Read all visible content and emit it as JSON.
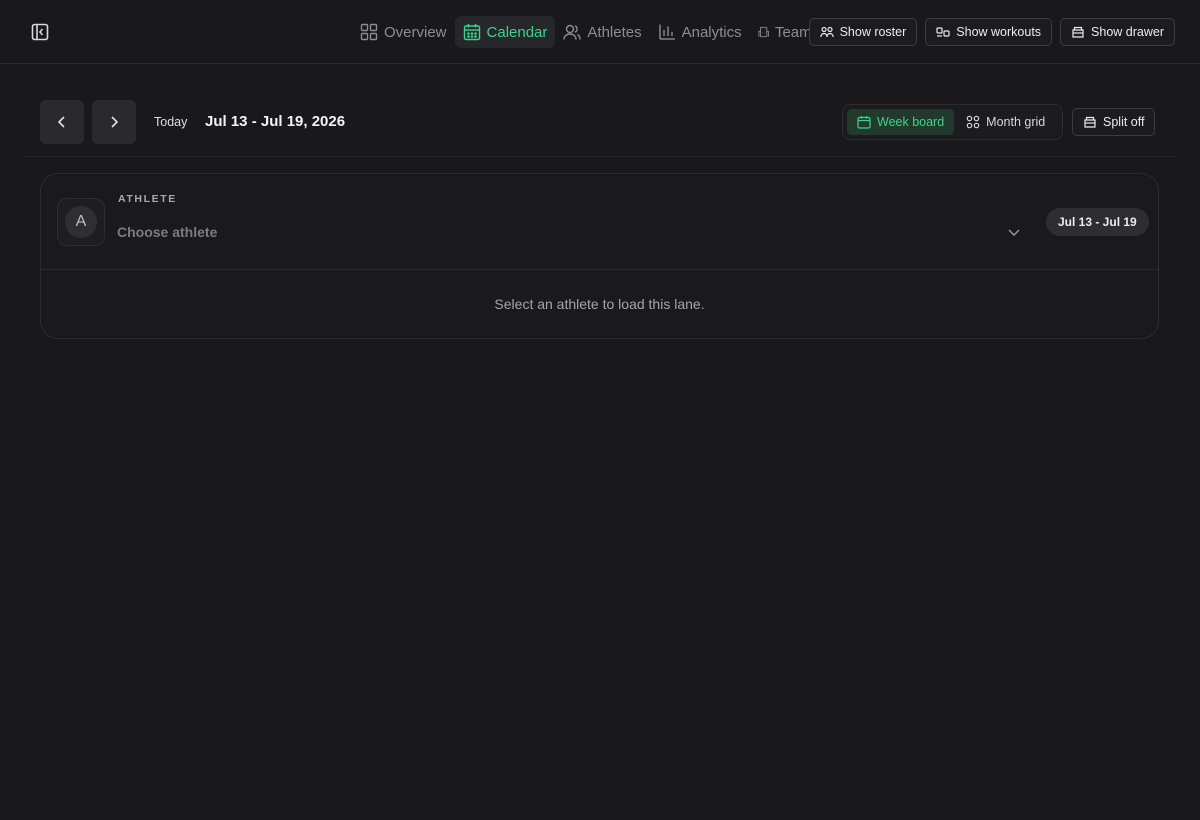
{
  "nav": {
    "items": [
      {
        "label": "Overview",
        "icon": "grid-icon"
      },
      {
        "label": "Calendar",
        "icon": "calendar-icon",
        "active": true
      },
      {
        "label": "Athletes",
        "icon": "users-icon"
      },
      {
        "label": "Analytics",
        "icon": "bar-chart-icon"
      },
      {
        "label": "Team",
        "icon": "building-icon"
      }
    ]
  },
  "actions": {
    "roster": "Show roster",
    "workouts": "Show workouts",
    "drawer": "Show drawer"
  },
  "toolbar": {
    "today": "Today",
    "range_title": "Jul 13 - Jul 19, 2026",
    "views": {
      "week": "Week board",
      "month": "Month grid"
    },
    "split": "Split off"
  },
  "lane": {
    "avatar_initial": "A",
    "label": "ATHLETE",
    "placeholder": "Choose athlete",
    "range_badge": "Jul 13 - Jul 19",
    "empty_message": "Select an athlete to load this lane."
  },
  "colors": {
    "accent": "#3ad58a",
    "background": "#19191b"
  }
}
